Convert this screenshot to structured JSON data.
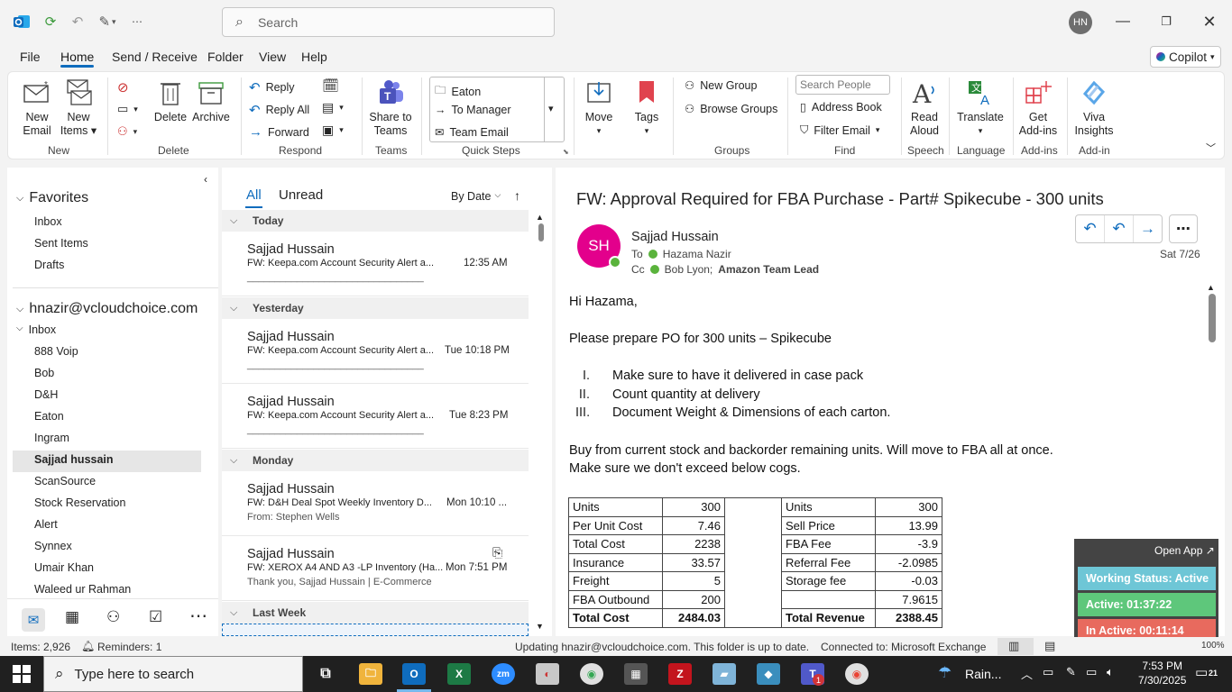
{
  "titlebar": {
    "search_placeholder": "Search",
    "user_initials": "HN"
  },
  "menu": {
    "tabs": [
      "File",
      "Home",
      "Send / Receive",
      "Folder",
      "View",
      "Help"
    ],
    "active": "Home",
    "copilot": "Copilot"
  },
  "ribbon": {
    "new_email": [
      "New",
      "Email"
    ],
    "new_items": [
      "New",
      "Items"
    ],
    "delete": "Delete",
    "archive": "Archive",
    "reply": "Reply",
    "reply_all": "Reply All",
    "forward": "Forward",
    "share_to_teams": [
      "Share to",
      "Teams"
    ],
    "quick_steps": [
      "Eaton",
      "To Manager",
      "Team Email"
    ],
    "move": "Move",
    "tags": "Tags",
    "new_group": "New Group",
    "browse_groups": "Browse Groups",
    "search_people_placeholder": "Search People",
    "address_book": "Address Book",
    "filter_email": "Filter Email",
    "read_aloud": [
      "Read",
      "Aloud"
    ],
    "translate": "Translate",
    "get_addins": [
      "Get",
      "Add-ins"
    ],
    "viva_insights": [
      "Viva",
      "Insights"
    ],
    "groups": [
      "New",
      "Delete",
      "Respond",
      "Teams",
      "Quick Steps",
      "Groups",
      "Find",
      "Speech",
      "Language",
      "Add-ins",
      "Add-in"
    ]
  },
  "folders": {
    "favorites_label": "Favorites",
    "favorites": [
      "Inbox",
      "Sent Items",
      "Drafts"
    ],
    "account": "hnazir@vcloudchoice.com",
    "inbox_label": "Inbox",
    "subfolders": [
      "888 Voip",
      "Bob",
      "D&H",
      "Eaton",
      "Ingram",
      "Sajjad hussain",
      "ScanSource",
      "Stock Reservation",
      "Alert",
      "Synnex",
      "Umair Khan",
      "Waleed ur Rahman"
    ],
    "selected": "Sajjad hussain"
  },
  "message_list": {
    "tab_all": "All",
    "tab_unread": "Unread",
    "sort": "By Date",
    "groups": {
      "today": "Today",
      "yesterday": "Yesterday",
      "monday": "Monday",
      "last_week": "Last Week"
    },
    "messages": [
      {
        "from": "Sajjad Hussain",
        "subject": "FW: Keepa.com Account Security Alert a...",
        "time": "12:35 AM",
        "preview": "________________________________"
      },
      {
        "from": "Sajjad Hussain",
        "subject": "FW: Keepa.com Account Security Alert a...",
        "time": "Tue 10:18 PM",
        "preview": "________________________________"
      },
      {
        "from": "Sajjad Hussain",
        "subject": "FW: Keepa.com Account Security Alert a...",
        "time": "Tue 8:23 PM",
        "preview": "________________________________"
      },
      {
        "from": "Sajjad Hussain",
        "subject": "FW: D&H Deal Spot Weekly Inventory D...",
        "time": "Mon 10:10 ...",
        "preview": "From: Stephen Wells"
      },
      {
        "from": "Sajjad Hussain",
        "subject": "FW: XEROX A4 AND A3 -LP Inventory (Ha...",
        "time": "Mon 7:51 PM",
        "preview": "Thank you,  Sajjad Hussain | E-Commerce"
      }
    ]
  },
  "reading_pane": {
    "subject": "FW: Approval Required for FBA Purchase - Part# Spikecube - 300 units",
    "avatar_initials": "SH",
    "sender": "Sajjad Hussain",
    "to_label": "To",
    "to": "Hazama Nazir",
    "cc_label": "Cc",
    "cc": "Bob Lyon;",
    "cc_bold": "Amazon Team Lead",
    "date": "Sat 7/26",
    "greeting": "Hi Hazama,",
    "line1": "Please prepare PO for 300 units – Spikecube",
    "list": [
      {
        "num": "I.",
        "text": "Make sure to have it delivered in case pack"
      },
      {
        "num": "II.",
        "text": "Count quantity at delivery"
      },
      {
        "num": "III.",
        "text": "Document Weight & Dimensions of each carton."
      }
    ],
    "para1": "Buy from current stock and backorder remaining units. Will move to FBA all at once.",
    "para2": "Make sure we don't exceed below cogs.",
    "cost_table": [
      [
        "Units",
        "300"
      ],
      [
        "Per Unit Cost",
        "7.46"
      ],
      [
        "Total Cost",
        "2238"
      ],
      [
        "Insurance",
        "33.57"
      ],
      [
        "Freight",
        "5"
      ],
      [
        "FBA Outbound",
        "200"
      ],
      [
        "Total Cost",
        "2484.03"
      ]
    ],
    "revenue_table": [
      [
        "Units",
        "300"
      ],
      [
        "Sell Price",
        "13.99"
      ],
      [
        "FBA Fee",
        "-3.9"
      ],
      [
        "Referral Fee",
        "-2.0985"
      ],
      [
        "Storage fee",
        "-0.03"
      ],
      [
        "",
        "7.9615"
      ],
      [
        "Total Revenue",
        "2388.45"
      ]
    ]
  },
  "working_status": {
    "open_app": "Open App ↗",
    "status": "Working Status: Active",
    "active": "Active: 01:37:22",
    "inactive": "In Active: 00:11:14"
  },
  "statusbar": {
    "items": "Items: 2,926",
    "reminders": "Reminders: 1",
    "updating": "Updating hnazir@vcloudchoice.com.  This folder is up to date.",
    "connected": "Connected to: Microsoft Exchange",
    "zoom": "100%"
  },
  "taskbar": {
    "search_placeholder": "Type here to search",
    "weather": "Rain...",
    "time": "7:53 PM",
    "date": "7/30/2025",
    "notifications": "21",
    "teams_badge": "1"
  }
}
